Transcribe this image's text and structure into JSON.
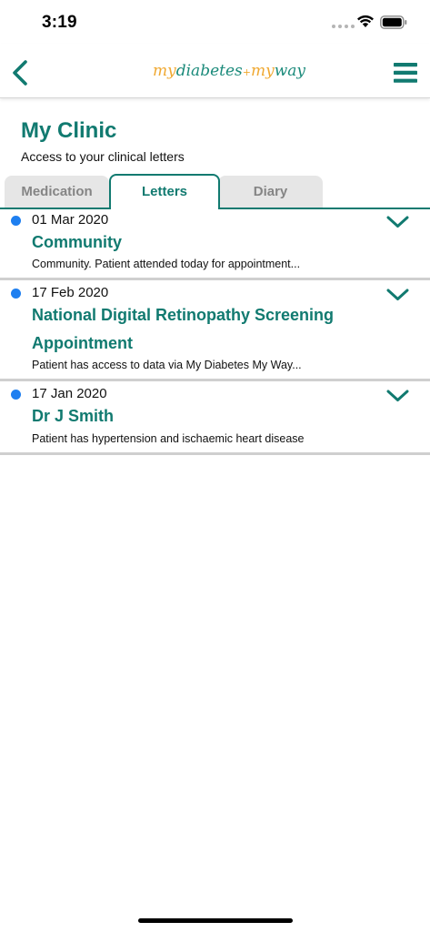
{
  "status_bar": {
    "time": "3:19"
  },
  "nav": {
    "logo_my": "my",
    "logo_diabetes": "diabetes",
    "logo_plus": "+",
    "logo_my2": "my",
    "logo_way": "way"
  },
  "header": {
    "title": "My Clinic",
    "subtitle": "Access to your clinical letters"
  },
  "tabs": [
    {
      "label": "Medication"
    },
    {
      "label": "Letters"
    },
    {
      "label": "Diary"
    }
  ],
  "letters": [
    {
      "date": "01 Mar 2020",
      "title": "Community",
      "snippet": "Community. Patient attended today for appointment..."
    },
    {
      "date": "17 Feb 2020",
      "title": "National Digital Retinopathy Screening Appointment",
      "snippet": "Patient has access to data via My Diabetes My Way..."
    },
    {
      "date": "17 Jan 2020",
      "title": "Dr J Smith",
      "snippet": "Patient has hypertension and ischaemic heart disease"
    }
  ],
  "colors": {
    "brand_teal": "#117a70",
    "logo_orange": "#f0a830",
    "unread_dot": "#1e7ff0"
  },
  "icons": {
    "back": "chevron-left-icon",
    "menu": "hamburger-menu-icon",
    "expand": "chevron-down-icon"
  }
}
